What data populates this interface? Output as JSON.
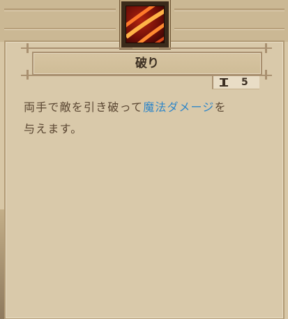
{
  "skill": {
    "name": "破り",
    "level": "5",
    "icon": "claw-slash-icon",
    "description_parts": [
      {
        "text": "両手で敵を引き破って",
        "highlight": false
      },
      {
        "text": "魔法ダメージ",
        "highlight": true
      },
      {
        "text": "を",
        "highlight": false
      }
    ],
    "description_line2": "与えます。"
  },
  "colors": {
    "highlight": "#2f86c8",
    "text": "#5a4632",
    "title": "#3c2f22",
    "icon_red": "#b1230f"
  }
}
